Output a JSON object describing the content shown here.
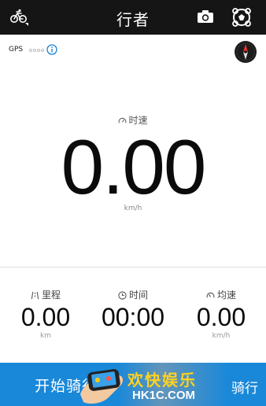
{
  "header": {
    "title": "行者",
    "icons": [
      "bike-menu-icon",
      "camera-icon",
      "hero-badge-icon"
    ]
  },
  "gps": {
    "label": "GPS",
    "signal_level": 0,
    "info_icon": "info-icon"
  },
  "speed": {
    "label": "时速",
    "value": "0.00",
    "unit": "km/h"
  },
  "stats": [
    {
      "label": "里程",
      "value": "0.00",
      "unit": "km",
      "icon": "road-icon"
    },
    {
      "label": "时间",
      "value": "00:00",
      "unit": "",
      "icon": "clock-icon"
    },
    {
      "label": "均速",
      "value": "0.00",
      "unit": "km/h",
      "icon": "gauge-icon"
    }
  ],
  "bottom": {
    "start_label": "开始骑行",
    "right_partial": "骑行"
  },
  "watermark": {
    "text": "欢快娱乐",
    "url": "HK1C.COM"
  },
  "colors": {
    "header_bg": "#151515",
    "start_bar": "#1a88d9",
    "watermark_yellow": "#ffd21e"
  }
}
